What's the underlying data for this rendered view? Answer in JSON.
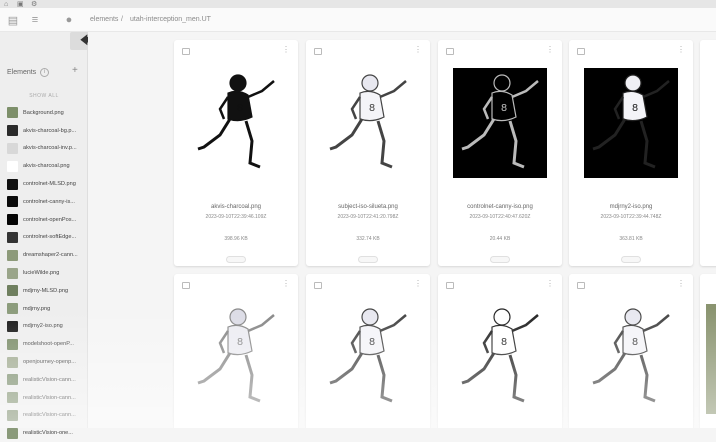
{
  "breadcrumb": {
    "root": "elements",
    "separator": "/",
    "current": "utah-interception_men.UT"
  },
  "sidebar": {
    "title": "Elements",
    "count": "i",
    "show_all": "SHOW ALL",
    "files": [
      {
        "label": "Background.png",
        "color": "#7d8f6a"
      },
      {
        "label": "akvis-charcoal-bg.p...",
        "color": "#2b2b2b"
      },
      {
        "label": "akvis-charcoal-inv.p...",
        "color": "#d8d8d8"
      },
      {
        "label": "akvis-charcoal.png",
        "color": "#ffffff"
      },
      {
        "label": "controlnet-MLSD.png",
        "color": "#111111"
      },
      {
        "label": "controlnet-canny-is...",
        "color": "#0a0a0a"
      },
      {
        "label": "controlnet-openPos...",
        "color": "#050505"
      },
      {
        "label": "controlnet-softEdge...",
        "color": "#333333"
      },
      {
        "label": "dreamshaper2-cann...",
        "color": "#8d9a7a"
      },
      {
        "label": "lucieWilde.png",
        "color": "#9aa58a"
      },
      {
        "label": "mdjrny-MLSD.png",
        "color": "#6f7f5f"
      },
      {
        "label": "mdjrny.png",
        "color": "#8c9c7c"
      },
      {
        "label": "mdjrny2-iso.png",
        "color": "#1a1a1a"
      },
      {
        "label": "modelshoot-openP...",
        "color": "#7a8c68"
      },
      {
        "label": "openjourney-openp...",
        "color": "#a0aa90"
      },
      {
        "label": "realisticVision-cann...",
        "color": "#7e9070"
      },
      {
        "label": "realisticVision-cann...",
        "color": "#869676"
      },
      {
        "label": "realisticVision-cann...",
        "color": "#7a8a6a"
      },
      {
        "label": "realisticVision-one...",
        "color": "#8a9a7a"
      }
    ]
  },
  "cards": [
    {
      "name": "akvis-charcoal.png",
      "date": "2023-09-10T22:39:46.109Z",
      "size": "398.96 KB",
      "style": "charcoal"
    },
    {
      "name": "subject-iso-silueta.png",
      "date": "2023-09-10T22:41:20.798Z",
      "size": "332.74 KB",
      "style": "photo"
    },
    {
      "name": "controlnet-canny-iso.png",
      "date": "2023-09-10T22:40:47.620Z",
      "size": "20.44 KB",
      "style": "canny"
    },
    {
      "name": "mdjrny2-iso.png",
      "date": "2023-09-10T22:39:44.748Z",
      "size": "363.81 KB",
      "style": "photo-dark"
    },
    {
      "name": "",
      "date": "",
      "size": "",
      "style": "photo-faded"
    },
    {
      "name": "",
      "date": "",
      "size": "",
      "style": "photo"
    },
    {
      "name": "",
      "date": "",
      "size": "",
      "style": "line"
    },
    {
      "name": "",
      "date": "",
      "size": "",
      "style": "photo"
    }
  ],
  "icons": {
    "back": "arrow-left-icon",
    "add": "plus-icon",
    "menu": "more-vert-icon",
    "image": "image-icon",
    "logo": "app-logo-icon",
    "hamburger": "menu-icon"
  }
}
